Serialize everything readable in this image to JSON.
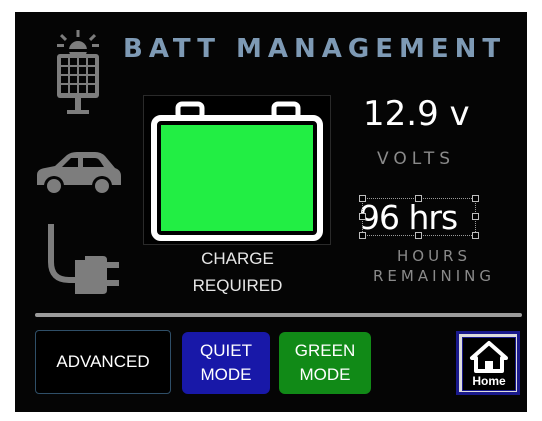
{
  "header": {
    "title": "BATT MANAGEMENT"
  },
  "icons": [
    "solar-panel-icon",
    "car-icon",
    "power-plug-icon",
    "battery-icon",
    "home-icon"
  ],
  "battery": {
    "status_line1": "CHARGE",
    "status_line2": "REQUIRED",
    "fill_color": "#22ee44"
  },
  "voltage": {
    "value": "12.9 v",
    "label": "VOLTS"
  },
  "hours": {
    "value": "96 hrs",
    "label_line1": "HOURS",
    "label_line2": "REMAINING"
  },
  "buttons": {
    "advanced": "ADVANCED",
    "quiet_line1": "QUIET",
    "quiet_line2": "MODE",
    "green_line1": "GREEN",
    "green_line2": "MODE",
    "home": "Home"
  },
  "colors": {
    "background": "#050505",
    "title": "#7e9ab5",
    "quiet_mode": "#1818a8",
    "green_mode": "#118a17"
  }
}
